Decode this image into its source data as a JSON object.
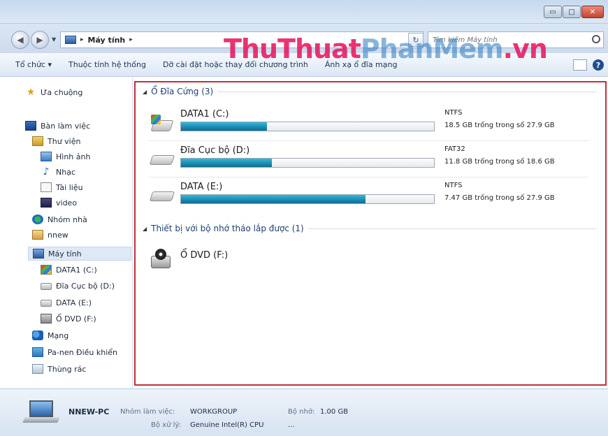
{
  "window": {
    "minimize": "▭",
    "maximize": "□",
    "close": "✕"
  },
  "address": {
    "crumbs": [
      "Máy tính"
    ],
    "arrow": "▸",
    "refresh": "↻",
    "search_placeholder": "Tìm kiếm Máy tính"
  },
  "toolbar": {
    "items": [
      "Tổ chức ▾",
      "Thuộc tính hệ thống",
      "Dỡ cài đặt hoặc thay đổi chương trình",
      "Ánh xạ ổ đĩa mạng"
    ]
  },
  "watermark": {
    "part1": "ThuThuat",
    "part2": "PhanMem",
    "part3": ".vn"
  },
  "sidebar": {
    "favorites": "Ưa chuộng",
    "desktop": "Bàn làm việc",
    "libraries": "Thư viện",
    "pictures": "Hình ảnh",
    "music": "Nhạc",
    "documents": "Tài liệu",
    "video": "video",
    "homegroup": "Nhóm nhà",
    "user": "nnew",
    "computer": "Máy tính",
    "drive_c": "DATA1 (C:)",
    "drive_d": "Đĩa Cục bộ (D:)",
    "drive_e": "DATA (E:)",
    "drive_f": "Ổ DVD (F:)",
    "network": "Mạng",
    "control_panel": "Pa-nen Điều khiển",
    "recycle_bin": "Thùng rác"
  },
  "main": {
    "group_hdd": "Ổ Đĩa Cứng (3)",
    "group_removable": "Thiết bị với bộ nhớ tháo lắp được (1)",
    "drives": [
      {
        "name": "DATA1 (C:)",
        "fs": "NTFS",
        "free": "18.5 GB trống trong số 27.9 GB",
        "used_fraction": 0.34
      },
      {
        "name": "Đĩa Cục bộ (D:)",
        "fs": "FAT32",
        "free": "11.8 GB trống trong số 18.6 GB",
        "used_fraction": 0.36
      },
      {
        "name": "DATA (E:)",
        "fs": "NTFS",
        "free": "7.47 GB trống trong số 27.9 GB",
        "used_fraction": 0.73
      }
    ],
    "dvd": "Ổ DVD (F:)"
  },
  "details": {
    "pc_name": "NNEW-PC",
    "workgroup_label": "Nhóm làm việc:",
    "workgroup": "WORKGROUP",
    "memory_label": "Bộ nhớ:",
    "memory": "1.00 GB",
    "cpu_label": "Bộ xử lý:",
    "cpu": "Genuine Intel(R) CPU",
    "cpu_more": "..."
  }
}
